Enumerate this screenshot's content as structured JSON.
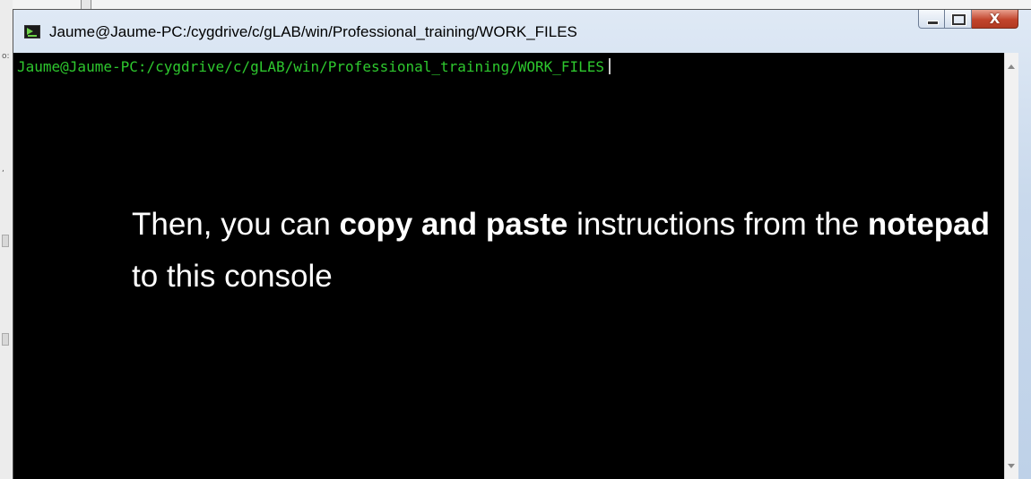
{
  "window": {
    "title": "Jaume@Jaume-PC:/cygdrive/c/gLAB/win/Professional_training/WORK_FILES",
    "controls": {
      "minimize": "minimize",
      "maximize": "maximize",
      "close": "X"
    }
  },
  "console": {
    "prompt": "Jaume@Jaume-PC:/cygdrive/c/gLAB/win/Professional_training/WORK_FILES",
    "overlay": {
      "part1": "Then, you can ",
      "bold1": "copy and paste",
      "part2": " instructions from the ",
      "bold2": "notepad",
      "part3": " to this console"
    }
  },
  "background": {
    "fragment1": "o:",
    "fragment2": ","
  },
  "colors": {
    "prompt_text": "#2ec82e",
    "console_bg": "#000000",
    "close_button": "#c2452d"
  }
}
